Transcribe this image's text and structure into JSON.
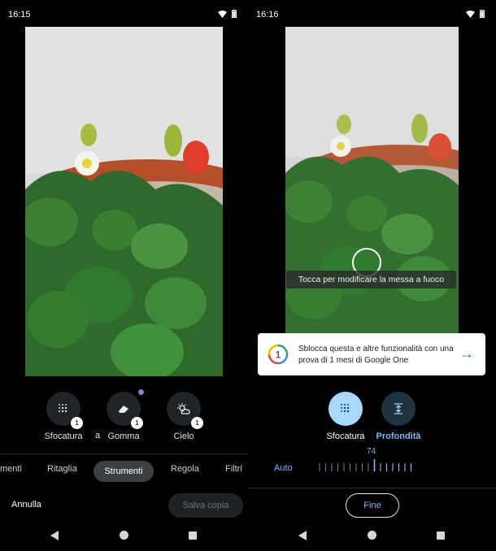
{
  "left_screen": {
    "time": "16:15",
    "tools": [
      {
        "name": "blur-tool",
        "label": "Sfocatura",
        "icon": "blur-dots-icon"
      },
      {
        "name": "eraser-tool",
        "label": "Gomma",
        "icon": "eraser-icon"
      },
      {
        "name": "sky-tool",
        "label": "Cielo",
        "icon": "sun-cloud-icon"
      }
    ],
    "truncated_label": "a",
    "tabs": [
      "menti",
      "Ritaglia",
      "Strumenti",
      "Regola",
      "Filtri"
    ],
    "active_tab": "Strumenti",
    "cancel_label": "Annulla",
    "save_label": "Salva copia"
  },
  "right_screen": {
    "time": "16:16",
    "focus_hint": "Tocca per modificare la messa a fuoco",
    "banner": {
      "text": "Sblocca questa e altre funzionalità con una prova di 1 mesi di Google One",
      "icon": "google-one-logo"
    },
    "modes": [
      {
        "label": "Sfocatura",
        "active": true
      },
      {
        "label": "Profondità",
        "active": false
      }
    ],
    "slider": {
      "auto_label": "Auto",
      "value": "74"
    },
    "done_label": "Fine"
  },
  "colors": {
    "background": "#000000",
    "accent_blue": "#8ab4f8",
    "active_mode_circle": "#a8d8ff"
  }
}
